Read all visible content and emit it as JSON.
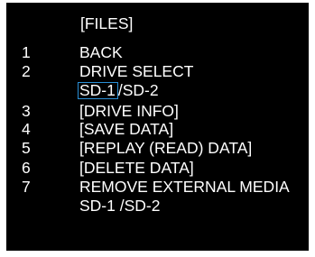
{
  "title": "[FILES]",
  "menu": [
    {
      "number": "1",
      "label": "BACK"
    },
    {
      "number": "2",
      "label": "DRIVE SELECT"
    },
    {
      "number": "3",
      "label": "[DRIVE INFO]"
    },
    {
      "number": "4",
      "label": "[SAVE DATA]"
    },
    {
      "number": "5",
      "label": "[REPLAY (READ) DATA]"
    },
    {
      "number": "6",
      "label": "[DELETE DATA]"
    },
    {
      "number": "7",
      "label": "REMOVE EXTERNAL MEDIA"
    }
  ],
  "drive_select_options": {
    "selected": "SD-1",
    "other": "/SD-2"
  },
  "remove_media_options": {
    "text": "SD-1 /SD-2"
  },
  "colors": {
    "background": "#000000",
    "text": "#ffffff",
    "selection_border": "#2a8fd6"
  }
}
